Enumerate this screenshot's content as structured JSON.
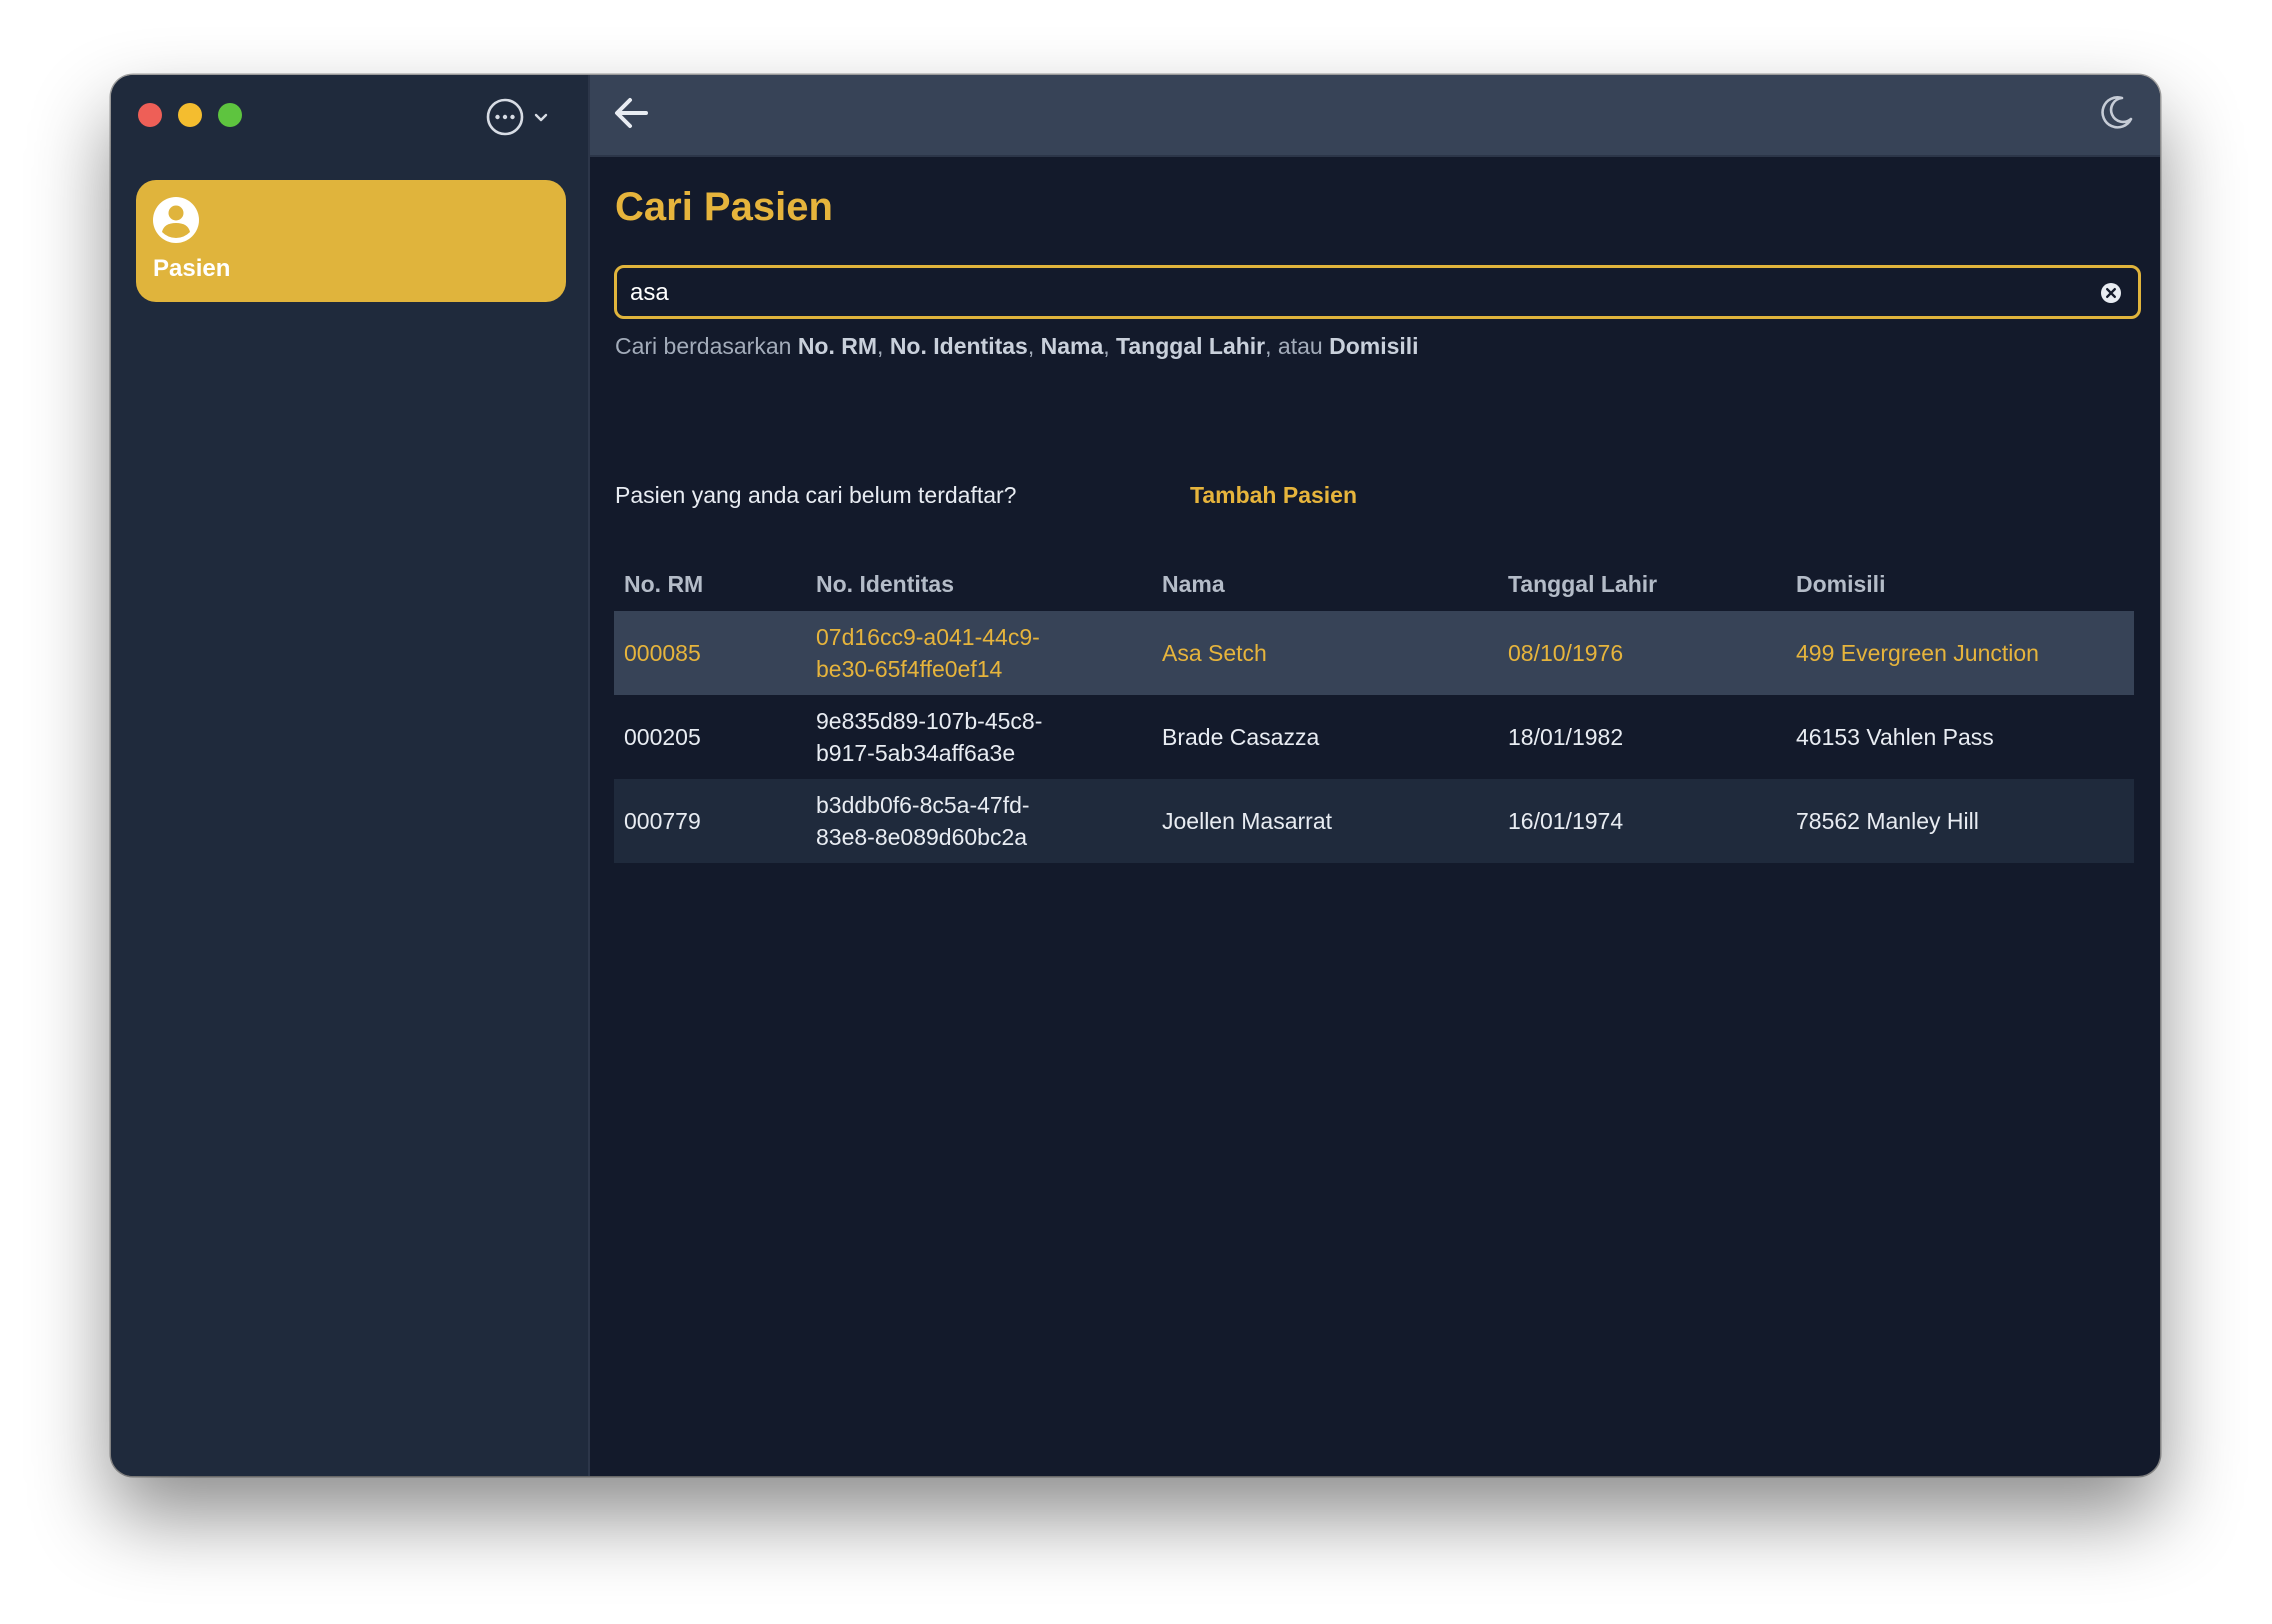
{
  "window": {
    "title_bar": {
      "more_menu_icon": "ellipsis-circle-icon",
      "chevron_icon": "chevron-down-icon"
    }
  },
  "sidebar": {
    "items": [
      {
        "label": "Pasien",
        "icon": "person-circle-icon",
        "active": true
      }
    ]
  },
  "topbar": {
    "back_icon": "arrow-left-icon",
    "theme_icon": "moon-icon"
  },
  "main": {
    "title": "Cari Pasien",
    "search": {
      "value": "asa",
      "placeholder": "",
      "clear_icon": "close-circle-icon",
      "hint": {
        "prefix": "Cari berdasarkan",
        "field1": "No. RM",
        "field2": "No. Identitas",
        "field3": "Nama",
        "field4": "Tanggal Lahir",
        "separator": ",",
        "conj": "atau",
        "field5": "Domisili"
      }
    },
    "not_registered_text": "Pasien yang anda cari belum terdaftar?",
    "add_patient_label": "Tambah Pasien",
    "table": {
      "headers": [
        "No. RM",
        "No. Identitas",
        "Nama",
        "Tanggal Lahir",
        "Domisili"
      ],
      "rows": [
        {
          "rm": "000085",
          "id_line1": "07d16cc9-a041-44c9-",
          "id_line2": "be30-65f4ffe0ef14",
          "name": "Asa Setch",
          "dob": "08/10/1976",
          "domicile": "499 Evergreen Junction",
          "selected": true
        },
        {
          "rm": "000205",
          "id_line1": "9e835d89-107b-45c8-",
          "id_line2": "b917-5ab34aff6a3e",
          "name": "Brade Casazza",
          "dob": "18/01/1982",
          "domicile": "46153 Vahlen Pass",
          "selected": false
        },
        {
          "rm": "000779",
          "id_line1": "b3ddb0f6-8c5a-47fd-",
          "id_line2": "83e8-8e089d60bc2a",
          "name": "Joellen Masarrat",
          "dob": "16/01/1974",
          "domicile": "78562 Manley Hill",
          "selected": false
        }
      ]
    }
  },
  "colors": {
    "accent": "#e0b43c",
    "sidebar_bg": "#1f2a3c",
    "main_bg": "#131a2b",
    "topbar_bg": "#374357"
  }
}
